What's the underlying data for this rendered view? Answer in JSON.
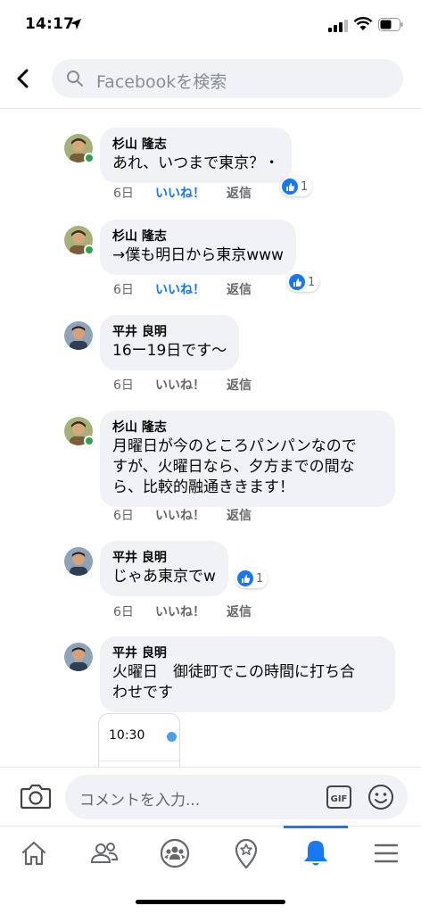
{
  "status_bar": {
    "time": "14:17"
  },
  "search": {
    "placeholder": "Facebookを検索"
  },
  "comments": [
    {
      "author": "杉山 隆志",
      "text": "あれ、いつまで東京？・",
      "time": "6日",
      "like": "いいね！",
      "reply": "返信",
      "liked": true,
      "reactions": "1",
      "online": true
    },
    {
      "author": "杉山 隆志",
      "text": "→僕も明日から東京www",
      "time": "6日",
      "like": "いいね！",
      "reply": "返信",
      "liked": true,
      "reactions": "1",
      "online": true
    },
    {
      "author": "平井 良明",
      "text": "16ー19日です〜",
      "time": "6日",
      "like": "いいね！",
      "reply": "返信",
      "liked": false,
      "online": false
    },
    {
      "author": "杉山 隆志",
      "text_lines": [
        "月曜日が今のところパンパンなので",
        "すが、火曜日なら、夕方までの間な",
        "ら、比較的融通ききます！"
      ],
      "time": "6日",
      "like": "いいね！",
      "reply": "返信",
      "liked": false,
      "online": true
    },
    {
      "author": "平井 良明",
      "text": "じゃあ東京でw",
      "time": "6日",
      "like": "いいね！",
      "reply": "返信",
      "liked": false,
      "reactions": "1",
      "online": false
    },
    {
      "author": "平井 良明",
      "text_lines": [
        "火曜日　御徒町でこの時間に打ち合",
        "わせです"
      ],
      "online": false
    }
  ],
  "shared_card": {
    "time": "10:30"
  },
  "composer": {
    "placeholder": "コメントを入力..."
  },
  "tabs": [
    "home-icon",
    "friends-icon",
    "groups-icon",
    "pages-icon",
    "notifications-icon",
    "menu-icon"
  ],
  "colors": {
    "accent": "#1877f2",
    "bubble": "#f0f2f5",
    "online": "#31a24c"
  }
}
